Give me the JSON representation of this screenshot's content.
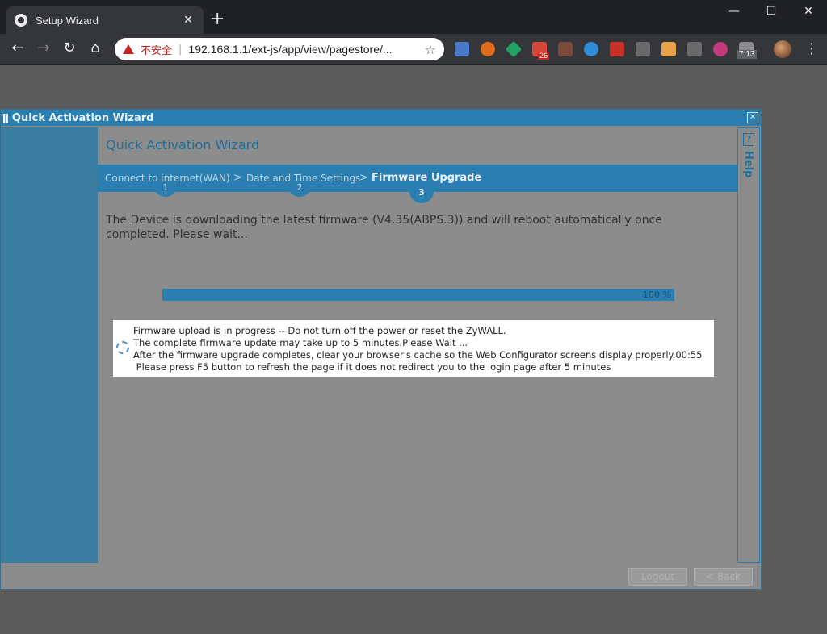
{
  "browser": {
    "tab_title": "Setup Wizard",
    "tab_close": "✕",
    "new_tab": "+",
    "minimize": "—",
    "maximize": "☐",
    "close": "✕",
    "insecure_label": "不安全",
    "url": "192.168.1.1/ext-js/app/view/pagestore/...",
    "mail_badge": "26",
    "time_badge": "7:13"
  },
  "wizard": {
    "window_title": "Quick Activation Wizard",
    "close_label": "✕",
    "title": "Quick Activation Wizard",
    "steps": [
      {
        "label": "Connect to internet(WAN)",
        "number": "1"
      },
      {
        "label": "Date and Time Settings",
        "number": "2"
      },
      {
        "label": "Firmware Upgrade",
        "number": "3"
      }
    ],
    "chevron": ">",
    "message": "The Device is downloading the latest firmware (V4.35(ABPS.3)) and will reboot automatically once completed. Please wait...",
    "progress_text": "100 %",
    "progress_fraction": 1.0,
    "help_label": "Help",
    "help_icon": "?",
    "footer_buttons": [
      "Logout",
      "< Back"
    ]
  },
  "modal": {
    "lines": [
      "Firmware upload is in progress -- Do not turn off the power or reset the ZyWALL.",
      "The complete firmware update may take up to 5 minutes.Please Wait ...",
      "After the firmware upgrade completes, clear your browser's cache so the Web Configurator screens display properly.00:55",
      " Please press F5 button to refresh the page if it does not redirect you to the login page after 5 minutes"
    ]
  }
}
